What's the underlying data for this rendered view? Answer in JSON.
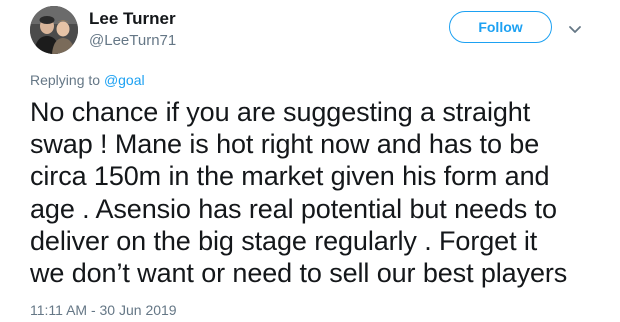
{
  "tweet": {
    "author": {
      "display_name": "Lee Turner",
      "handle": "@LeeTurn71"
    },
    "follow_label": "Follow",
    "replying_prefix": "Replying to",
    "replying_to": "@goal",
    "text_lines": [
      "No chance if you are suggesting a straight",
      "swap ! Mane is hot right now and has to be",
      "circa 150m in the market given his form and",
      "age . Asensio has real potential but needs to",
      "deliver on the big stage regularly . Forget it",
      "we don’t want or need to sell our best players"
    ],
    "timestamp": "11:11 AM - 30 Jun 2019"
  },
  "icons": {
    "more": "chevron-down-icon",
    "avatar": "profile-photo"
  },
  "colors": {
    "accent": "#1da1f2",
    "primary_text": "#14171a",
    "secondary_text": "#657786",
    "background": "#ffffff"
  }
}
